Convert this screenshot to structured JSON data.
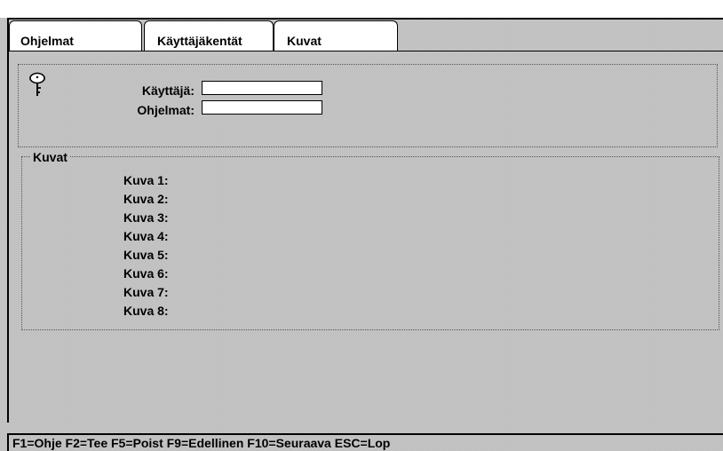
{
  "tabs": [
    {
      "label": "Ohjelmat"
    },
    {
      "label": "Käyttäjäkentät"
    },
    {
      "label": "Kuvat"
    }
  ],
  "user_group": {
    "icon": "key-icon",
    "user_label": "Käyttäjä:",
    "user_value": "",
    "programs_label": "Ohjelmat:",
    "programs_value": ""
  },
  "images": {
    "title": "Kuvat",
    "items": [
      "Kuva 1:",
      "Kuva 2:",
      "Kuva 3:",
      "Kuva 4:",
      "Kuva 5:",
      "Kuva 6:",
      "Kuva 7:",
      "Kuva 8:"
    ]
  },
  "statusbar": {
    "text": "F1=Ohje  F2=Tee  F5=Poist  F9=Edellinen  F10=Seuraava  ESC=Lop"
  }
}
